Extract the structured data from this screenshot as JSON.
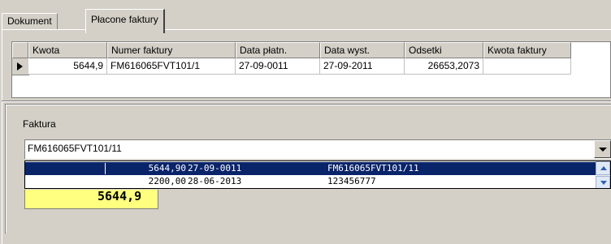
{
  "tabs": [
    {
      "label": "Dokument"
    },
    {
      "label": "Płacone faktury"
    }
  ],
  "grid": {
    "columns": [
      "Kwota",
      "Numer faktury",
      "Data płatn.",
      "Data wyst.",
      "Odsetki",
      "Kwota faktury"
    ],
    "rows": [
      [
        "5644,9",
        "FM616065FVT101/1",
        "27-09-0011",
        "27-09-2011",
        "26653,2073",
        ""
      ]
    ]
  },
  "invoice": {
    "label": "Faktura",
    "selected": "FM616065FVT101/11",
    "options": [
      {
        "amount": "5644,90",
        "date": "27-09-0011",
        "number": "FM616065FVT101/11"
      },
      {
        "amount": "2200,00",
        "date": "28-06-2013",
        "number": "123456777"
      }
    ],
    "amount_display": "5644,9"
  },
  "colors": {
    "selection": "#0a246a",
    "amount_bg": "#ffff80",
    "window_bg": "#d4d0c8"
  }
}
